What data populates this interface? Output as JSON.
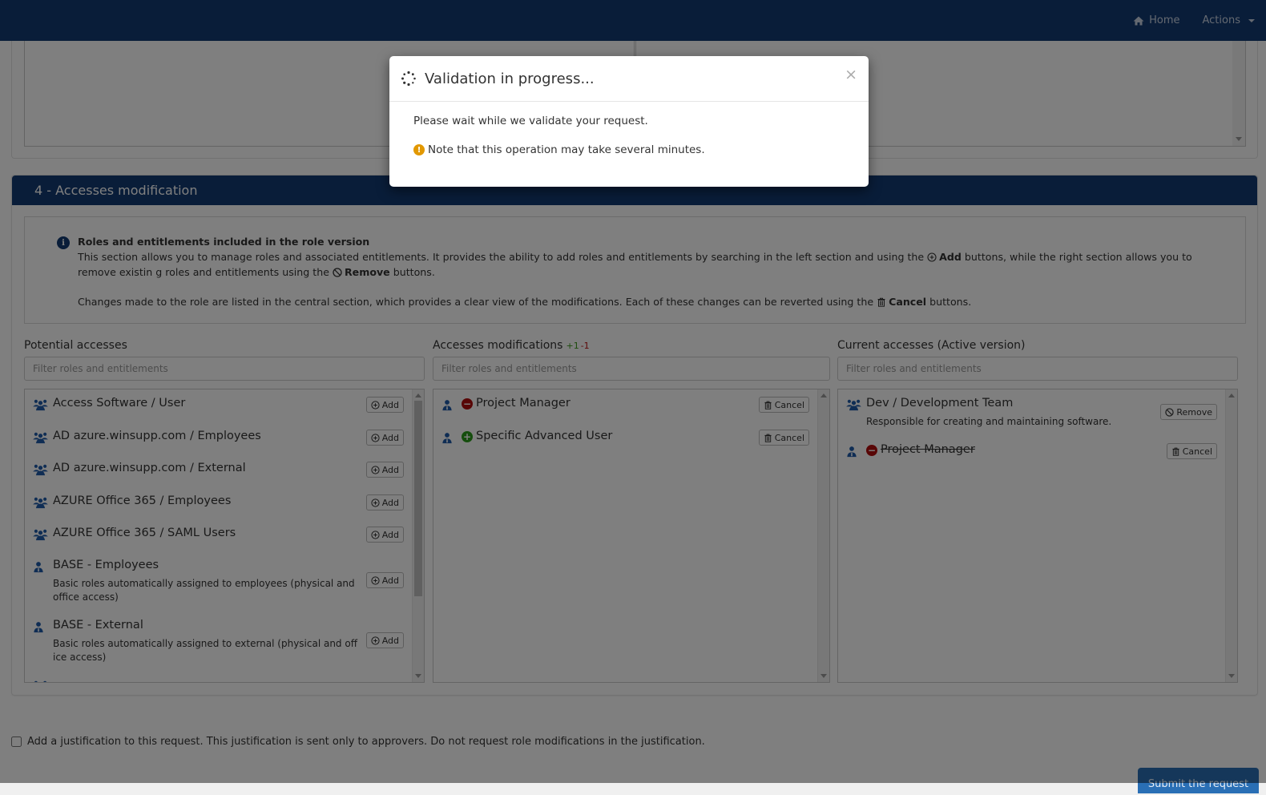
{
  "navbar": {
    "home_label": "Home",
    "actions_label": "Actions"
  },
  "section4": {
    "title": "4 - Accesses modification",
    "info": {
      "title": "Roles and entitlements included in the role version",
      "para1_a": "This section allows you to manage roles and associated entitlements. It provides the ability to add roles and entitlements by searching in the left section and using the ",
      "para1_add": "Add",
      "para1_b": " buttons, while the right section allows you to remove existin g roles and entitlements using the ",
      "para1_remove": "Remove",
      "para1_c": " buttons.",
      "para2_a": "Changes made to the role are listed in the central section, which provides a clear view of the modifications. Each of these changes can be reverted using the ",
      "para2_cancel": "Cancel",
      "para2_b": " buttons."
    },
    "potential": {
      "label": "Potential accesses",
      "filter_placeholder": "Filter roles and entitlements",
      "items": [
        {
          "type": "group",
          "title": "Access Software / User",
          "desc": "",
          "button": "Add"
        },
        {
          "type": "group",
          "title": "AD azure.winsupp.com / Employees",
          "desc": "",
          "button": "Add"
        },
        {
          "type": "group",
          "title": "AD azure.winsupp.com / External",
          "desc": "",
          "button": "Add"
        },
        {
          "type": "group",
          "title": "AZURE Office 365 / Employees",
          "desc": "",
          "button": "Add"
        },
        {
          "type": "group",
          "title": "AZURE Office 365 / SAML Users",
          "desc": "",
          "button": "Add"
        },
        {
          "type": "role",
          "title": "BASE - Employees",
          "desc": "Basic roles automatically assigned to employees (physical and office access)",
          "button": "Add"
        },
        {
          "type": "role",
          "title": "BASE - External",
          "desc": "Basic roles automatically assigned to external (physical and office access)",
          "button": "Add"
        }
      ]
    },
    "modifications": {
      "label": "Accesses modifications",
      "added_count": "+1",
      "removed_count": "-1",
      "filter_placeholder": "Filter roles and entitlements",
      "items": [
        {
          "type": "role",
          "status": "removed",
          "title": "Project Manager",
          "button": "Cancel"
        },
        {
          "type": "role",
          "status": "added",
          "title": "Specific Advanced User",
          "button": "Cancel"
        }
      ]
    },
    "current": {
      "label": "Current accesses (Active version)",
      "filter_placeholder": "Filter roles and entitlements",
      "items": [
        {
          "type": "group",
          "title": "Dev / Development Team",
          "desc": "Responsible for creating and maintaining software.",
          "button": "Remove"
        },
        {
          "type": "role",
          "status": "removed",
          "title": "Project Manager",
          "button": "Cancel"
        }
      ]
    }
  },
  "justification": {
    "label": "Add a justification to this request. This justification is sent only to approvers. Do not request role modifications in the justification.",
    "checked": false
  },
  "submit_label": "Submit the request",
  "modal": {
    "title": "Validation in progress...",
    "message": "Please wait while we validate your request.",
    "note": "Note that this operation may take several minutes.",
    "close_symbol": "×"
  },
  "colors": {
    "brand": "#123a72",
    "added": "#2b9a1b",
    "removed": "#b10d0d",
    "warning": "#e29800"
  }
}
